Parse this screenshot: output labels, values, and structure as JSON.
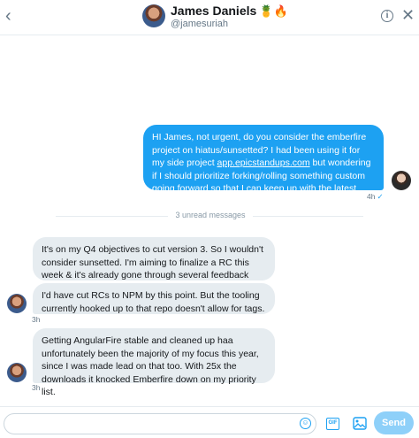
{
  "header": {
    "name": "James Daniels",
    "emoji": "🍍🔥",
    "handle": "@jamesuriah"
  },
  "messages": [
    {
      "direction": "sent",
      "text_before": "HI James, not urgent, do you consider the emberfire project on hiatus/sunsetted? I had been using it for my side project ",
      "link": "app.epicstandups.com",
      "text_after": " but wondering if I should prioritize forking/rolling something custom going forward so that I can keep up with the latest ember-data versions.",
      "time": "4h"
    },
    {
      "direction": "received",
      "text": "It's on my Q4 objectives to cut version 3. So I wouldn't consider sunsetted. I'm aiming to finalize a RC this week & it's already gone through several feedback sessions."
    },
    {
      "direction": "received",
      "text": "I'd have cut RCs to NPM by this point. But the tooling currently hooked up to that repo doesn't allow for tags.",
      "time": "3h"
    },
    {
      "direction": "received",
      "text": "Getting AngularFire stable and cleaned up haa unfortunately been the majority of my focus this year, since I was made lead on that too. With 25x the downloads it knocked Emberfire down on my priority list.",
      "time": "3h"
    }
  ],
  "divider": "3 unread messages",
  "composer": {
    "value": "",
    "gif_label": "GIF",
    "send_label": "Send"
  },
  "colors": {
    "accent": "#1da1f2",
    "received_bubble": "#e6ecf0",
    "send_disabled": "#8ed0f9"
  }
}
